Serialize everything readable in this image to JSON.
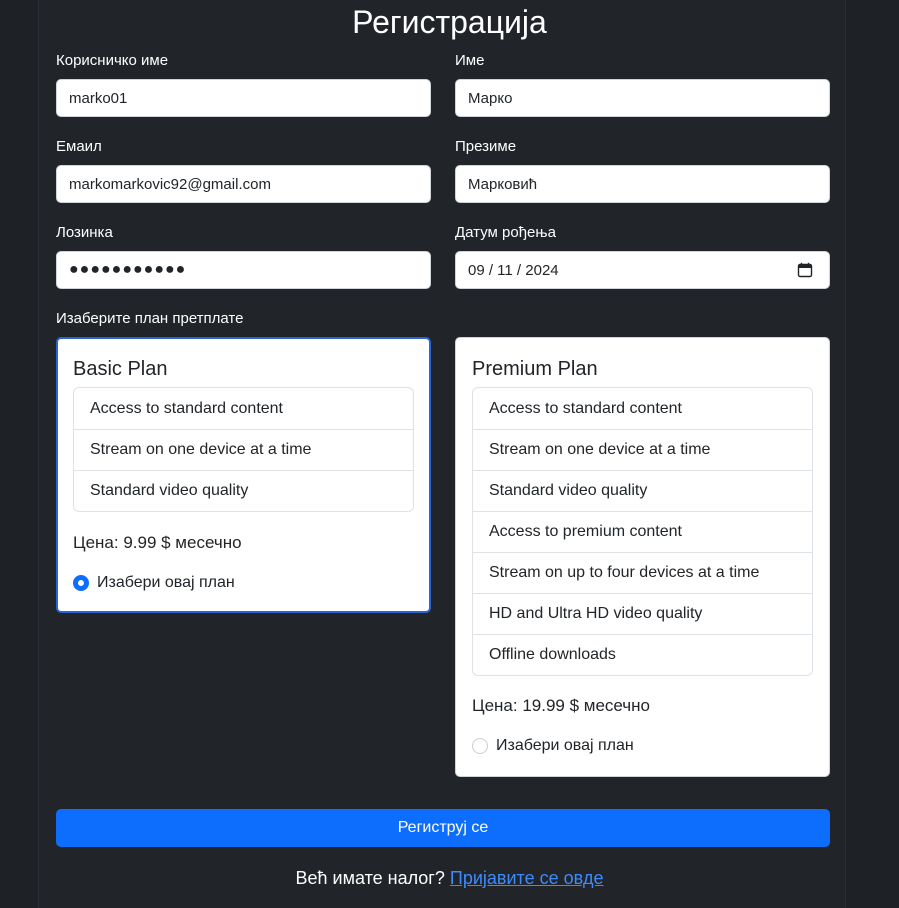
{
  "page_title": "Регистрација",
  "fields": {
    "username": {
      "label": "Корисничко име",
      "value": "marko01"
    },
    "first_name": {
      "label": "Име",
      "value": "Марко"
    },
    "email": {
      "label": "Емаил",
      "value": "markomarkovic92@gmail.com"
    },
    "last_name": {
      "label": "Презиме",
      "value": "Марковић"
    },
    "password": {
      "label": "Лозинка",
      "value": "●●●●●●●●●●●"
    },
    "birth_date": {
      "label": "Датум рођења",
      "value": "09 / 11 / 2024",
      "icon": "calendar-icon"
    }
  },
  "plan_section_label": "Изаберите план претплате",
  "plans": [
    {
      "title": "Basic Plan",
      "features": [
        "Access to standard content",
        "Stream on one device at a time",
        "Standard video quality"
      ],
      "price": "Цена: 9.99 $ месечно",
      "select_label": "Изабери овај план",
      "selected": true
    },
    {
      "title": "Premium Plan",
      "features": [
        "Access to standard content",
        "Stream on one device at a time",
        "Standard video quality",
        "Access to premium content",
        "Stream on up to four devices at a time",
        "HD and Ultra HD video quality",
        "Offline downloads"
      ],
      "price": "Цена: 19.99 $ месечно",
      "select_label": "Изабери овај план",
      "selected": false
    }
  ],
  "submit_label": "Региструј се",
  "footer": {
    "text": "Већ имате налог?",
    "link": "Пријавите се овде"
  },
  "colors": {
    "background": "#212529",
    "primary": "#0d6efd",
    "link": "#3d8bfd"
  }
}
